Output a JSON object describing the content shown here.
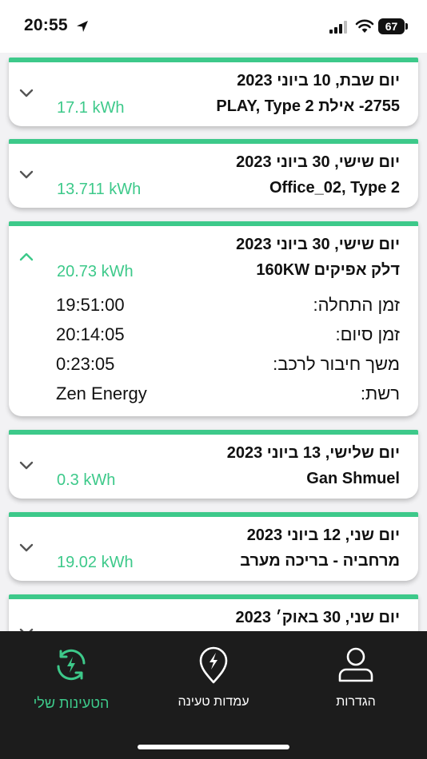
{
  "status_bar": {
    "time": "20:55",
    "battery": "67"
  },
  "sessions": [
    {
      "date": "יום שבת, 10 ביוני 2023",
      "location": "2755- אילת PLAY, Type 2",
      "energy": "17.1 kWh",
      "expanded": false
    },
    {
      "date": "יום שישי, 30 ביוני 2023",
      "location": "Office_02, Type 2",
      "energy": "13.711 kWh",
      "expanded": false
    },
    {
      "date": "יום שישי, 30 ביוני 2023",
      "location": "דלק אפיקים 160KW",
      "energy": "20.73 kWh",
      "expanded": true,
      "details": [
        {
          "label": "זמן התחלה:",
          "value": "19:51:00"
        },
        {
          "label": "זמן סיום:",
          "value": "20:14:05"
        },
        {
          "label": "משך חיבור לרכב:",
          "value": "0:23:05"
        },
        {
          "label": "רשת:",
          "value": "Zen Energy"
        }
      ]
    },
    {
      "date": "יום שלישי, 13 ביוני 2023",
      "location": "Gan Shmuel",
      "energy": "0.3 kWh",
      "expanded": false
    },
    {
      "date": "יום שני, 12 ביוני 2023",
      "location": "מרחביה - בריכה מערב",
      "energy": "19.02 kWh",
      "expanded": false
    },
    {
      "date": "יום שני, 30 באוק׳ 2023",
      "expanded": false
    }
  ],
  "tab_bar": {
    "tabs": [
      {
        "label": "הטעינות שלי",
        "icon": "charging-history-icon",
        "active": true
      },
      {
        "label": "עמדות טעינה",
        "icon": "charging-station-pin-icon",
        "active": false
      },
      {
        "label": "הגדרות",
        "icon": "user-profile-icon",
        "active": false
      }
    ]
  },
  "colors": {
    "accent": "#3dc98a",
    "tab_bar_bg": "#1c1c1c",
    "page_bg": "#f2f2f4"
  }
}
